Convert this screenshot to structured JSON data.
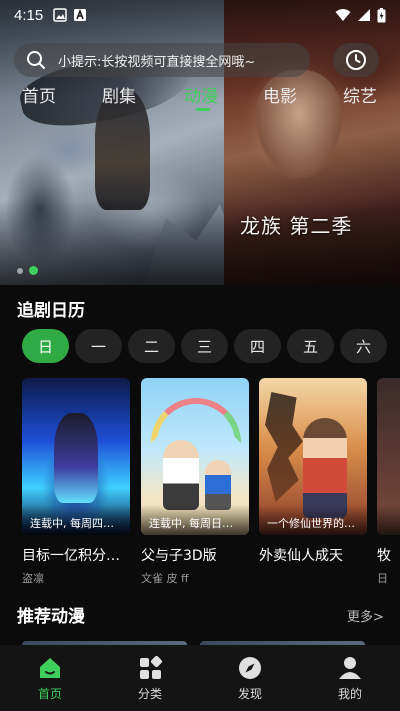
{
  "status_bar": {
    "time": "4:15"
  },
  "search": {
    "placeholder": "小提示:长按视频可直接搜全网哦~"
  },
  "tabs": [
    {
      "label": "首页"
    },
    {
      "label": "剧集"
    },
    {
      "label": "动漫",
      "active": true
    },
    {
      "label": "电影"
    },
    {
      "label": "综艺"
    }
  ],
  "banner": {
    "caption": "龙族 第二季",
    "slide_count": 2,
    "active_slide": 2
  },
  "calendar": {
    "title": "追剧日历",
    "days": [
      {
        "label": "日",
        "active": true
      },
      {
        "label": "一"
      },
      {
        "label": "二"
      },
      {
        "label": "三"
      },
      {
        "label": "四"
      },
      {
        "label": "五"
      },
      {
        "label": "六"
      }
    ],
    "shows": [
      {
        "title": "目标一亿积分…",
        "subtitle": "盗凛",
        "badge": "连载中, 每周四…"
      },
      {
        "title": "父与子3D版",
        "subtitle": "文雀 皮 ff",
        "badge": "连载中, 每周日…"
      },
      {
        "title": "外卖仙人成天",
        "subtitle": "",
        "badge": "一个修仙世界的…"
      },
      {
        "title": "牧",
        "subtitle": "日",
        "badge": ""
      }
    ]
  },
  "recommend": {
    "title": "推荐动漫",
    "more_label": "更多>"
  },
  "bottom_nav": [
    {
      "label": "首页",
      "icon": "home-icon",
      "active": true
    },
    {
      "label": "分类",
      "icon": "category-icon"
    },
    {
      "label": "发现",
      "icon": "compass-icon"
    },
    {
      "label": "我的",
      "icon": "profile-icon"
    }
  ],
  "colors": {
    "accent": "#3ecf5c",
    "background": "#0b0b0b",
    "chip": "#232323"
  }
}
